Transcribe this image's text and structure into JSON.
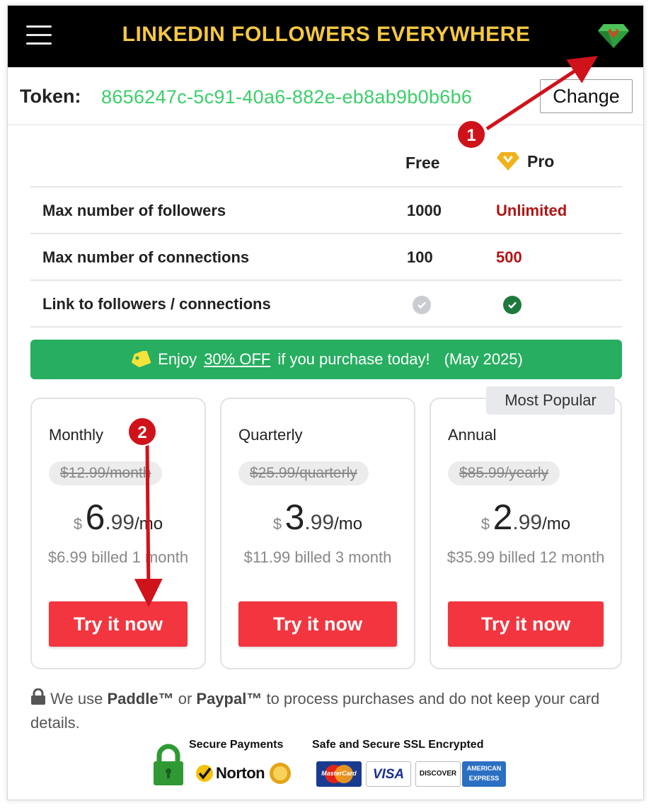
{
  "header": {
    "title": "LINKEDIN FOLLOWERS EVERYWHERE",
    "menu_icon": "hamburger-menu-icon",
    "pro_icon": "pro-gem-icon"
  },
  "token": {
    "label": "Token:",
    "value": "8656247c-5c91-40a6-882e-eb8ab9b0b6b6",
    "change_label": "Change"
  },
  "comparison": {
    "col_free": "Free",
    "col_pro": "Pro",
    "rows": [
      {
        "feature": "Max number of followers",
        "free": "1000",
        "pro": "Unlimited"
      },
      {
        "feature": "Max number of connections",
        "free": "100",
        "pro": "500"
      },
      {
        "feature": "Link to followers / connections",
        "free_icon": "check-gray-icon",
        "pro_icon": "check-green-icon"
      }
    ]
  },
  "promo": {
    "prefix": "Enjoy",
    "discount": "30% OFF",
    "suffix": "if you purchase today!",
    "date": "(May 2025)"
  },
  "plans": [
    {
      "name": "Monthly",
      "old_price": "$12.99/month",
      "currency": "$",
      "price_int": "6",
      "price_dec": ".99",
      "per": "/mo",
      "billed": "$6.99 billed 1 month",
      "cta": "Try it now"
    },
    {
      "name": "Quarterly",
      "old_price": "$25.99/quarterly",
      "currency": "$",
      "price_int": "3",
      "price_dec": ".99",
      "per": "/mo",
      "billed": "$11.99 billed 3 month",
      "cta": "Try it now"
    },
    {
      "name": "Annual",
      "old_price": "$85.99/yearly",
      "currency": "$",
      "price_int": "2",
      "price_dec": ".99",
      "per": "/mo",
      "billed": "$35.99 billed 12 month",
      "cta": "Try it now",
      "badge": "Most Popular"
    }
  ],
  "notice": {
    "lead": "We use",
    "paddle": "Paddle™",
    "or": "or",
    "paypal": "Paypal™",
    "rest": "to process purchases and do not keep your card details."
  },
  "badges": {
    "secure_payments": "Secure Payments",
    "ssl": "Safe and Secure SSL Encrypted",
    "norton": "Norton",
    "visa": "VISA",
    "discover": "DISCOVER",
    "mastercard": "MasterCard",
    "amex_line1": "AMERICAN",
    "amex_line2": "EXPRESS"
  },
  "annotations": [
    {
      "number": "1"
    },
    {
      "number": "2"
    }
  ],
  "colors": {
    "header_bg": "#000000",
    "title": "#f5c842",
    "token": "#3ccf6a",
    "pro_value": "#b01515",
    "promo_bg": "#27ae60",
    "cta": "#f2353f",
    "annotation": "#d0121b"
  }
}
